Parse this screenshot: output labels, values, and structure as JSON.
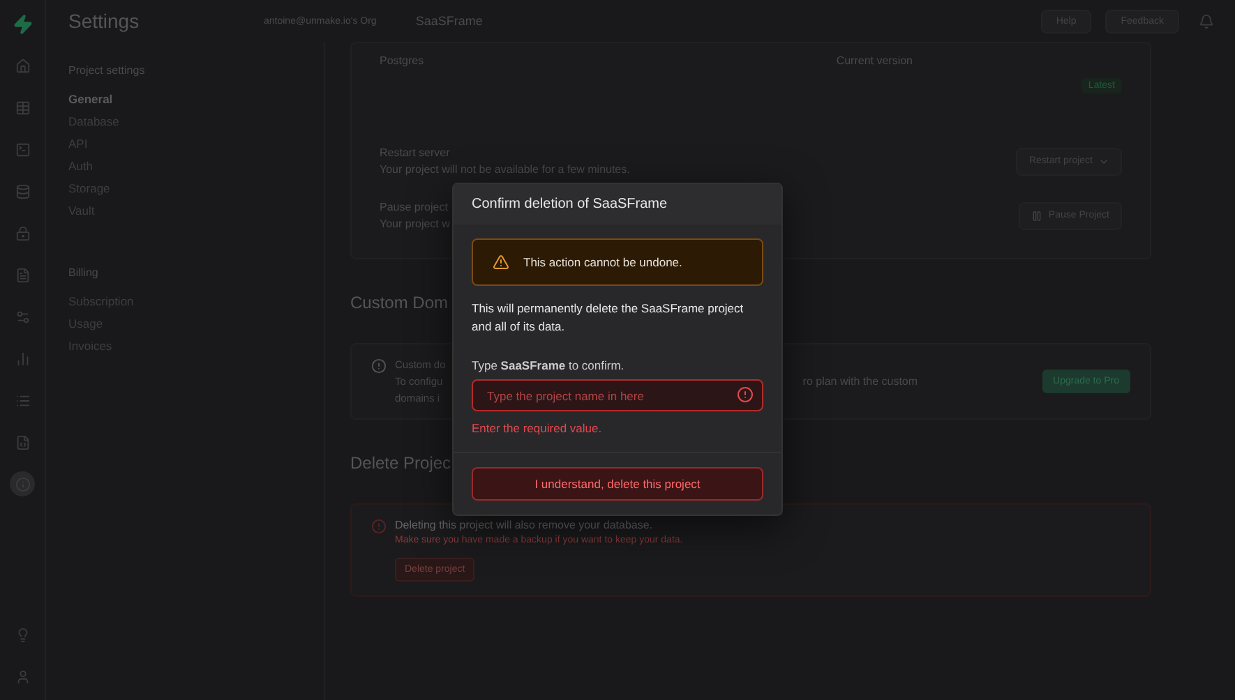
{
  "header": {
    "title": "Settings",
    "org": "antoine@unmake.io's Org",
    "project": "SaaSFrame",
    "buttons": [
      "Help",
      "Feedback"
    ]
  },
  "sidebar": {
    "sections": [
      {
        "title": "Project settings",
        "items": [
          {
            "label": "General",
            "selected": true
          },
          {
            "label": "Database",
            "selected": false
          },
          {
            "label": "API",
            "selected": false
          },
          {
            "label": "Auth",
            "selected": false
          },
          {
            "label": "Storage",
            "selected": false
          },
          {
            "label": "Vault",
            "selected": false
          }
        ]
      },
      {
        "title": "Billing",
        "items": [
          {
            "label": "Subscription",
            "selected": false
          },
          {
            "label": "Usage",
            "selected": false
          },
          {
            "label": "Invoices",
            "selected": false
          }
        ]
      }
    ]
  },
  "general": {
    "postgres_label": "Postgres",
    "version_label": "Current version",
    "badge": "Latest",
    "rows": [
      {
        "title": "Restart server",
        "description": "Your project will not be available for a few minutes.",
        "button": "Restart project",
        "kind": "menu"
      },
      {
        "title": "Pause project",
        "description": "Your project w",
        "button": "Pause Project",
        "kind": "pause"
      }
    ]
  },
  "custom_domains": {
    "heading": "Custom Dom",
    "notice_title": "Custom do",
    "notice_lines": [
      "To configu",
      "domains i"
    ],
    "notice_tail": "ro plan with the custom",
    "button": "Upgrade to Pro"
  },
  "delete_project": {
    "heading": "Delete Projec",
    "notice_title": "Deleting this project will also remove your database.",
    "notice_text": "Make sure you have made a backup if you want to keep your data.",
    "button": "Delete project"
  },
  "dialog": {
    "title": "Confirm deletion of SaaSFrame",
    "warning": "This action cannot be undone.",
    "description": "This will permanently delete the SaaSFrame project and all of its data.",
    "prompt": "Type **SaaSFrame** to confirm.",
    "placeholder": "Type the project name in here",
    "error": "Enter the required value.",
    "confirm_button": "I understand, delete this project"
  }
}
